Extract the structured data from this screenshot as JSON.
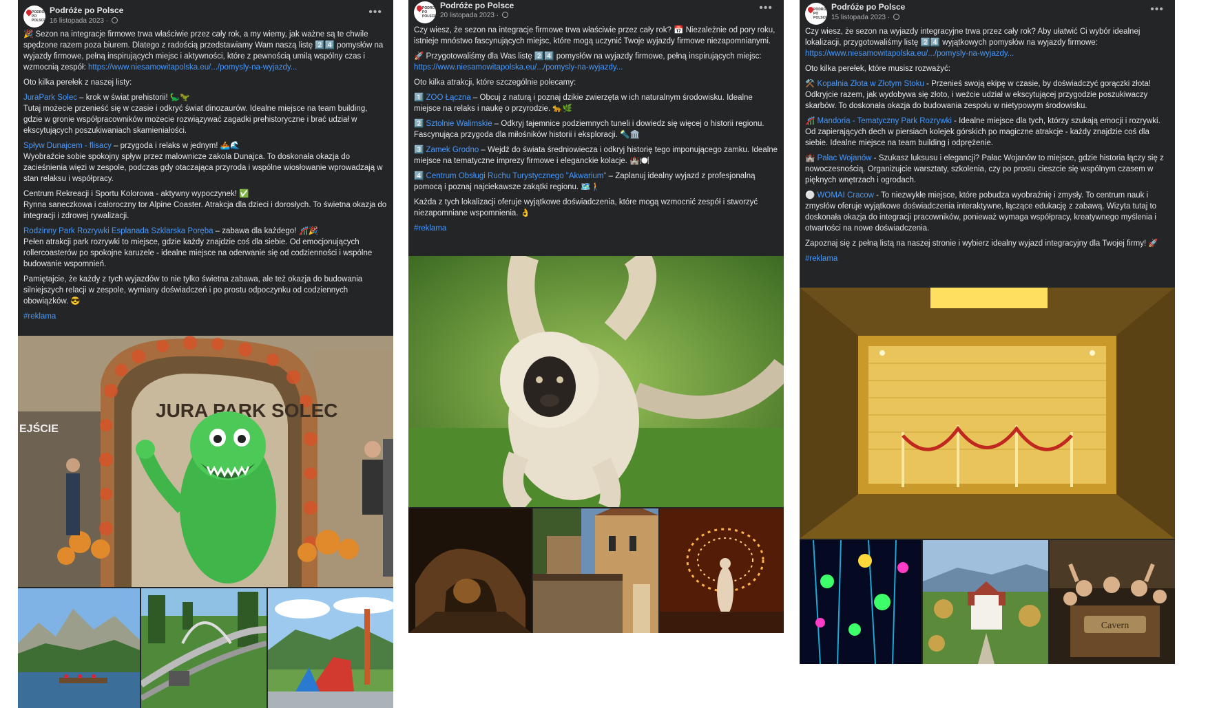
{
  "posts": [
    {
      "page_name": "Podróże po Polsce",
      "date": "16 listopada 2023",
      "paragraphs": [
        {
          "pre": "🎉 Sezon na integracje firmowe trwa właściwie przez cały rok, a my wiemy, jak ważne są te chwile spędzone razem poza biurem. Dlatego z radością przedstawiamy Wam naszą listę 2️⃣4️⃣ pomysłów na wyjazdy firmowe, pełną inspirujących miejsc i aktywności, które z pewnością umilą wspólny czas i wzmocnią zespół: ",
          "link": "https://www.niesamowitapolska.eu/.../pomysly-na-wyjazdy..."
        },
        {
          "text": "Oto kilka perełek z naszej listy:"
        },
        {
          "highlight": "JuraPark Solec",
          "rest": " – krok w świat prehistorii! 🦕🦖",
          "body": "Tutaj możecie przenieść się w czasie i odkryć świat dinozaurów. Idealne miejsce na team building, gdzie w gronie współpracowników możecie rozwiązywać zagadki prehistoryczne i brać udział w ekscytujących poszukiwaniach skamieniałości."
        },
        {
          "highlight": "Spływ Dunajcem - flisacy",
          "rest": " – przygoda i relaks w jednym! 🚣🌊",
          "body": "Wyobraźcie sobie spokojny spływ przez malownicze zakola Dunajca. To doskonała okazja do zacieśnienia więzi w zespole, podczas gdy otaczająca przyroda i wspólne wiosłowanie wprowadzają w stan relaksu i współpracy."
        },
        {
          "text": "Centrum Rekreacji i Sportu Kolorowa - aktywny wypoczynek! ✅",
          "body": "Rynna saneczkowa i całoroczny tor Alpine Coaster. Atrakcja dla dzieci i dorosłych. To świetna okazja do integracji i zdrowej rywalizacji."
        },
        {
          "highlight": "Rodzinny Park Rozrywki Esplanada Szklarska Poręba",
          "rest": " – zabawa dla każdego! 🎢🎉",
          "body": "Pełen atrakcji park rozrywki to miejsce, gdzie każdy znajdzie coś dla siebie. Od emocjonujących rollercoasterów po spokojne karuzele - idealne miejsce na oderwanie się od codzienności i wspólne budowanie wspomnień."
        },
        {
          "text": "Pamiętajcie, że każdy z tych wyjazdów to nie tylko świetna zabawa, ale też okazja do budowania silniejszych relacji w zespole, wymiany doświadczeń i po prostu odpoczynku od codziennych obowiązków. 😎"
        }
      ],
      "hashtag": "#reklama",
      "main_image": {
        "alt": "JuraPark Solec dinosaur mascot",
        "sign": "JURA PARK SOLEC",
        "side_sign": "EJŚCIE"
      },
      "thumbs": [
        {
          "alt": "Pieniny river rafting"
        },
        {
          "alt": "Alpine coaster"
        },
        {
          "alt": "Amusement park"
        }
      ]
    },
    {
      "page_name": "Podróże po Polsce",
      "date": "20 listopada 2023",
      "paragraphs": [
        {
          "text": "Czy wiesz, że sezon na integracje firmowe trwa właściwie przez cały rok? 📅 Niezależnie od pory roku, istnieje mnóstwo fascynujących miejsc, które mogą uczynić Twoje wyjazdy firmowe niezapomnianymi."
        },
        {
          "pre": "🚀 Przygotowaliśmy dla Was listę 2️⃣4️⃣ pomysłów na wyjazdy firmowe, pełną inspirujących miejsc: ",
          "link": "https://www.niesamowitapolska.eu/.../pomysly-na-wyjazdy..."
        },
        {
          "text": "Oto kilka atrakcji, które szczególnie polecamy:"
        },
        {
          "num": "1️⃣",
          "highlight": "ZOO Łączna",
          "rest": " – Obcuj z naturą i poznaj dzikie zwierzęta w ich naturalnym środowisku. Idealne miejsce na relaks i naukę o przyrodzie. 🐆🌿"
        },
        {
          "num": "2️⃣",
          "highlight": "Sztolnie Walimskie",
          "rest": " – Odkryj tajemnice podziemnych tuneli i dowiedz się więcej o historii regionu. Fascynująca przygoda dla miłośników historii i eksploracji. 🔦🏛️"
        },
        {
          "num": "3️⃣",
          "highlight": "Zamek Grodno",
          "rest": " – Wejdź do świata średniowiecza i odkryj historię tego imponującego zamku. Idealne miejsce na tematyczne imprezy firmowe i eleganckie kolacje. 🏰🍽️"
        },
        {
          "num": "4️⃣",
          "highlight": "Centrum Obsługi Ruchu Turystycznego \"Akwarium\"",
          "rest": " – Zaplanuj idealny wyjazd z profesjonalną pomocą i poznaj najciekawsze zakątki regionu. 🗺️🚶"
        },
        {
          "text": "Każda z tych lokalizacji oferuje wyjątkowe doświadczenia, które mogą wzmocnić zespół i stworzyć niezapomniane wspomnienia. 👌"
        }
      ],
      "hashtag": "#reklama",
      "main_image": {
        "alt": "Gibbon at ZOO Łączna"
      },
      "thumbs": [
        {
          "alt": "Sztolnie Walimskie tunnel"
        },
        {
          "alt": "Zamek Grodno"
        },
        {
          "alt": "Fire show"
        }
      ]
    },
    {
      "page_name": "Podróże po Polsce",
      "date": "15 listopada 2023",
      "paragraphs": [
        {
          "pre": "Czy wiesz, że sezon na wyjazdy integracyjne trwa przez cały rok? Aby ułatwić Ci wybór idealnej lokalizacji, przygotowaliśmy listę 2️⃣4️⃣ wyjątkowych pomysłów na wyjazdy firmowe: ",
          "link": "https://www.niesamowitapolska.eu/.../pomysly-na-wyjazdy..."
        },
        {
          "text": "Oto kilka perełek, które musisz rozważyć:"
        },
        {
          "num": "⚒️",
          "highlight": "Kopalnia Złota w Złotym Stoku",
          "rest": " - Przenieś swoją ekipę w czasie, by doświadczyć gorączki złota! Odkryjcie razem, jak wydobywa się złoto, i weźcie udział w ekscytującej przygodzie poszukiwaczy skarbów. To doskonała okazja do budowania zespołu w nietypowym środowisku."
        },
        {
          "num": "🎢",
          "highlight": "Mandoria - Tematyczny Park Rozrywki",
          "rest": " - Idealne miejsce dla tych, którzy szukają emocji i rozrywki. Od zapierających dech w piersiach kolejek górskich po magiczne atrakcje - każdy znajdzie coś dla siebie. Idealne miejsce na team building i odprężenie."
        },
        {
          "num": "🏰",
          "highlight": "Pałac Wojanów",
          "rest": " - Szukasz luksusu i elegancji? Pałac Wojanów to miejsce, gdzie historia łączy się z nowoczesnością. Organizujcie warsztaty, szkolenia, czy po prostu cieszcie się wspólnym czasem w pięknych wnętrzach i ogrodach."
        },
        {
          "num": "⚪",
          "highlight": "WOMAI Cracow",
          "rest": " - To niezwykłe miejsce, które pobudza wyobraźnię i zmysły. To centrum nauk i zmysłów oferuje wyjątkowe doświadczenia interaktywne, łączące edukację z zabawą. Wizyta tutaj to doskonała okazja do integracji pracowników, ponieważ wymaga współpracy, kreatywnego myślenia i otwartości na nowe doświadczenia."
        },
        {
          "text": "Zapoznaj się z pełną listą na naszej stronie i wybierz idealny wyjazd integracyjny dla Twojej firmy! 🚀"
        }
      ],
      "hashtag": "#reklama",
      "main_image": {
        "alt": "Gold mine vault"
      },
      "thumbs": [
        {
          "alt": "WOMAI neon room"
        },
        {
          "alt": "Pałac Wojanów"
        },
        {
          "alt": "Mandoria ride",
          "sign": "Cavern"
        }
      ]
    }
  ],
  "colors": {
    "card_bg": "#242526",
    "text": "#e4e6eb",
    "meta": "#b0b3b8",
    "link": "#4599ff"
  }
}
